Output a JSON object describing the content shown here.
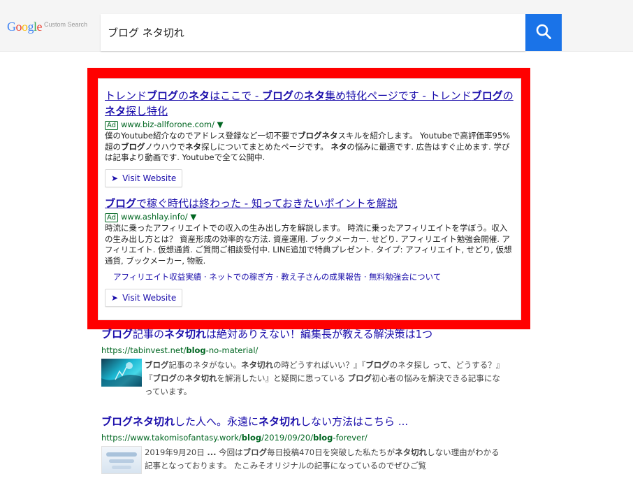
{
  "logo": {
    "text": "Google",
    "subtext": "Custom Search"
  },
  "search": {
    "query": "ブログ ネタ切れ",
    "button_icon": "search-icon"
  },
  "colors": {
    "highlight": "#ff0000",
    "link": "#1a0dab",
    "url": "#006621",
    "search_button": "#1a73e8"
  },
  "ads": [
    {
      "title_html": "トレンド<b>ブログ</b>の<b>ネタ</b>はここで - <b>ブログ</b>の<b>ネタ</b>集め特化ページです - トレンド<b>ブログ</b>の<b>ネタ</b>探し特化",
      "badge": "Ad",
      "url": "www.biz-allforone.com/",
      "desc_html": "僕のYoutube紹介なのでアドレス登録など一切不要で<b>ブログネタ</b>スキルを紹介します。 Youtubeで高評価率95%超の<b>ブログ</b>ノウハウで<b>ネタ</b>探しについてまとめたページです。 <b>ネタ</b>の悩みに最適です. 広告はすぐ止めます. 学びは記事より動画です. Youtubeで全て公開中.",
      "sitelinks": "",
      "visit_label": "Visit Website"
    },
    {
      "title_html": "<b>ブログ</b>で稼ぐ時代は終わった - 知っておきたいポイントを解説",
      "badge": "Ad",
      "url": "www.ashlay.info/",
      "desc_html": "時流に乗ったアフィリエイトでの収入の生み出し方を解説します。 時流に乗ったアフィリエイトを学ぼう。収入の生み出し方とは？ 資産形成の効率的な方法. 資産運用. ブックメーカー. せどり. アフィリエイト勉強会開催. アフィリエイト. 仮想通貨. ご質問ご相談受付中. LINE追加で特典プレゼント. タイプ: アフィリエイト, せどり, 仮想通貨, ブックメーカー, 物販.",
      "sitelinks": "アフィリエイト収益実績 · ネットでの稼ぎ方 · 教え子さんの成果報告 · 無料勉強会について",
      "visit_label": "Visit Website"
    }
  ],
  "results": [
    {
      "title_html": "<b>ブログ</b>記事の<b>ネタ切れ</b>は絶対ありえない！編集長が教える解決策は1つ",
      "url_html": "https://tabinvest.net/<b>blog</b>-no-material/",
      "snippet_html": "<b>ブログ</b>記事のネタがない。<b>ネタ切れ</b>の時どうすればいい？』『<b>ブログ</b>のネタ探し って、どうする？』『<b>ブログ</b>の<b>ネタ切れ</b>を解消したい』と疑問に思っている <b>ブログ</b>初心者の悩みを解決できる記事になっています。"
    },
    {
      "title_html": "<b>ブログネタ切れ</b>した人へ。永遠に<b>ネタ切れ</b>しない方法はこちら ...",
      "url_html": "https://www.takomisofantasy.work/<b>blog</b>/2019/09/20/<b>blog</b>-forever/",
      "snippet_html": "2019年9月20日 <b>...</b> 今回は<b>ブログ</b>毎日投稿470日を突破した私たちが<b>ネタ切れ</b>しない理由がわかる 記事となっております。 たこみそオリジナルの記事になっているのでぜひご覧"
    }
  ]
}
